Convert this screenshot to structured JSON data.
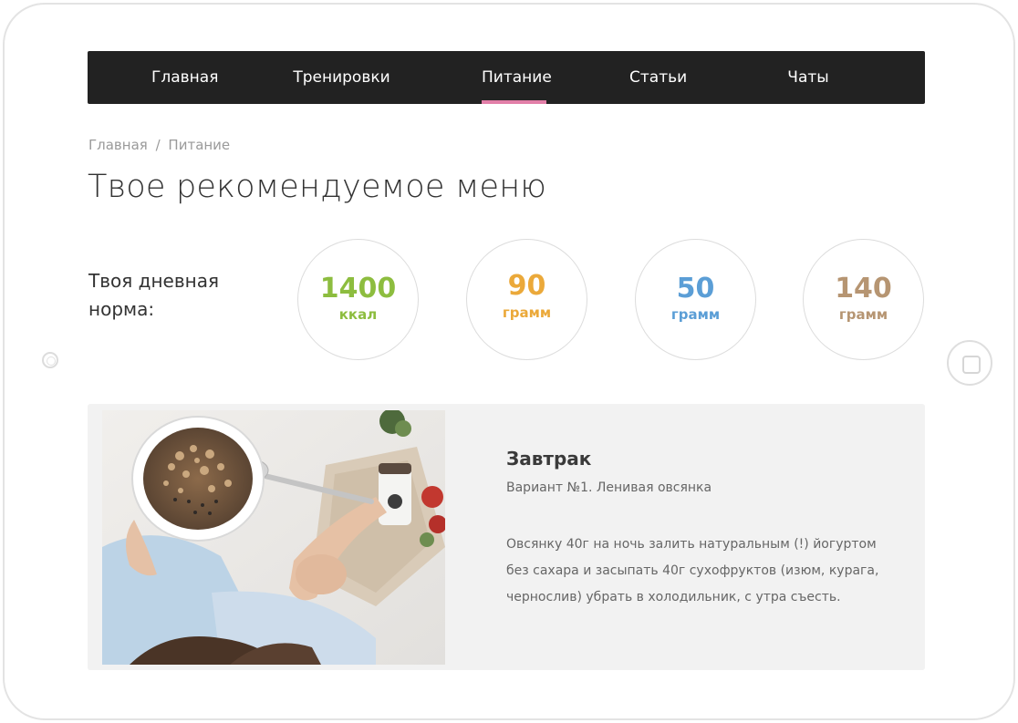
{
  "nav": {
    "items": [
      {
        "label": "Главная"
      },
      {
        "label": "Тренировки"
      },
      {
        "label": "Питание",
        "active": true
      },
      {
        "label": "Статьи"
      },
      {
        "label": "Чаты"
      }
    ]
  },
  "breadcrumb": {
    "home": "Главная",
    "separator": "/",
    "current": "Питание"
  },
  "page": {
    "title": "Твое рекомендуемое меню"
  },
  "daily_norm": {
    "label_line1": "Твоя дневная",
    "label_line2": "норма:",
    "stats": [
      {
        "value": "1400",
        "unit": "ккал",
        "color": "#8dbd3f"
      },
      {
        "value": "90",
        "unit": "грамм",
        "color": "#eba93a"
      },
      {
        "value": "50",
        "unit": "грамм",
        "color": "#5b9ed6"
      },
      {
        "value": "140",
        "unit": "грамм",
        "color": "#b69572"
      }
    ]
  },
  "meal": {
    "title": "Завтрак",
    "variant": "Вариант №1. Ленивая овсянка",
    "description_lines": [
      "Овсянку 40г на ночь залить натуральным (!) йогуртом",
      "без сахара и засыпать 40г сухофруктов (изюм, курага,",
      "чернослив) убрать в холодильник, с утра съесть."
    ],
    "photo_icon": "oatmeal-bowl-photo"
  },
  "colors": {
    "nav_bg": "#222222",
    "active_underline": "#e27fa8",
    "card_bg": "#f2f2f2"
  }
}
